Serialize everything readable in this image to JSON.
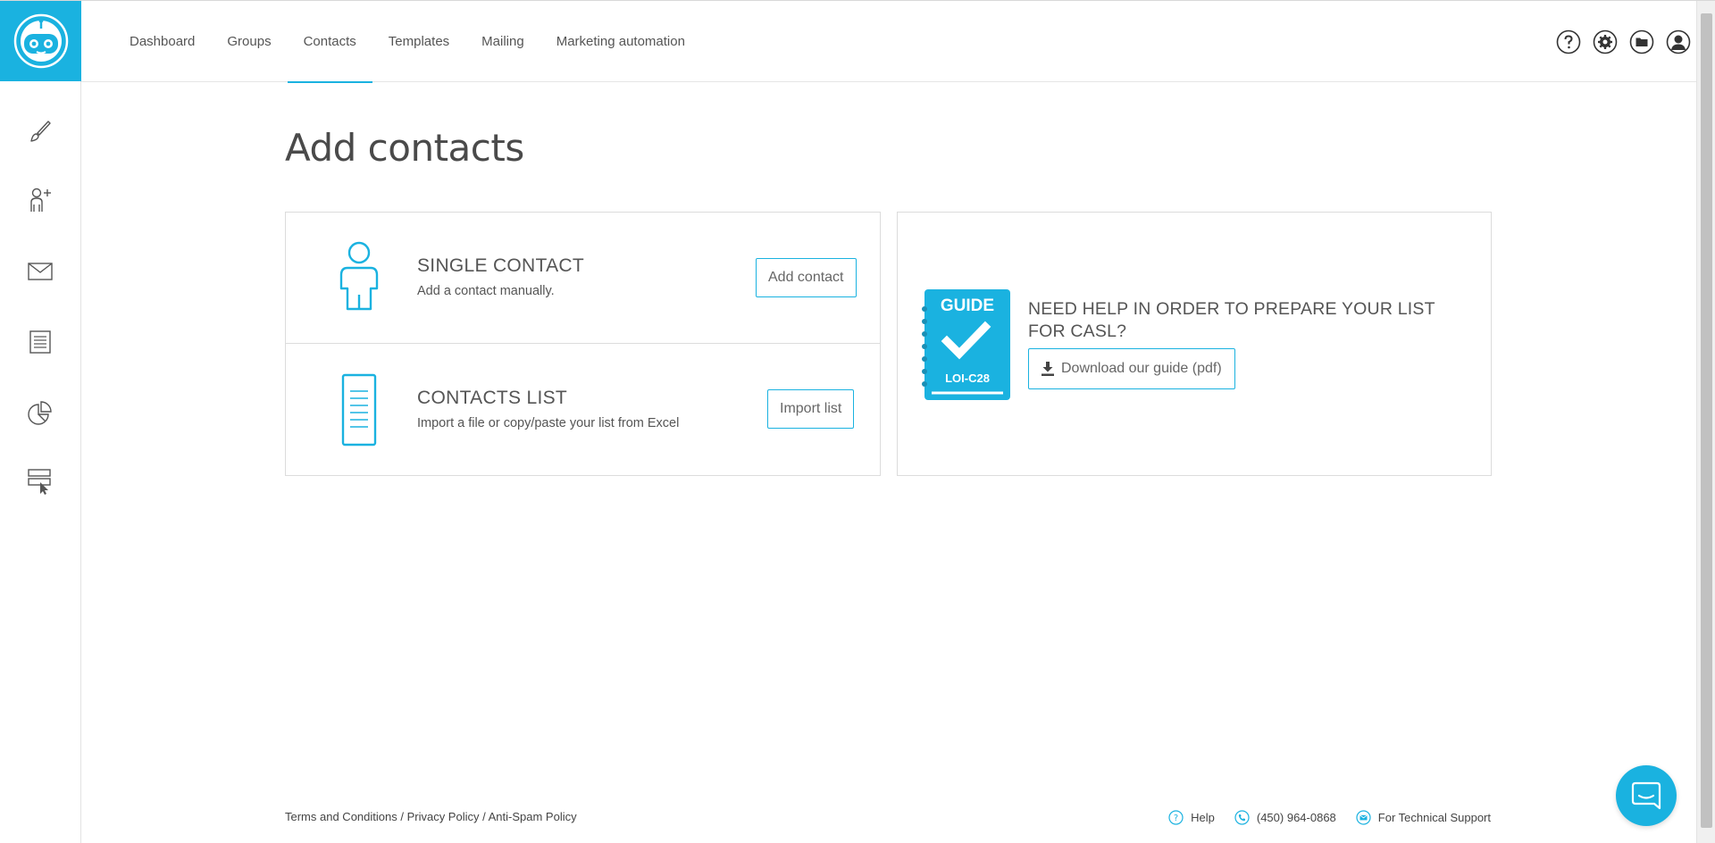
{
  "nav": {
    "tabs": [
      {
        "label": "Dashboard"
      },
      {
        "label": "Groups"
      },
      {
        "label": "Contacts"
      },
      {
        "label": "Templates"
      },
      {
        "label": "Mailing"
      },
      {
        "label": "Marketing automation"
      }
    ],
    "active_tab": "Contacts"
  },
  "sidebar": {
    "items": [
      "brush-icon",
      "add-contact-icon",
      "mail-icon",
      "document-icon",
      "report-chart-icon",
      "form-cursor-icon"
    ]
  },
  "header_icons": [
    "help-icon",
    "settings-icon",
    "folder-icon",
    "user-icon"
  ],
  "page": {
    "title": "Add contacts"
  },
  "single_contact": {
    "title": "SINGLE CONTACT",
    "subtitle": "Add a contact manually.",
    "button": "Add contact"
  },
  "contacts_list": {
    "title": "CONTACTS LIST",
    "subtitle": "Import a file or copy/paste your list from Excel",
    "button": "Import list"
  },
  "guide": {
    "badge_top": "GUIDE",
    "badge_bottom": "LOI-C28",
    "title": "NEED HELP IN ORDER TO PREPARE YOUR LIST FOR CASL?",
    "button": "Download our guide (pdf)"
  },
  "footer": {
    "terms": "Terms and Conditions",
    "privacy": "Privacy Policy",
    "antispam": "Anti-Spam Policy",
    "separator": " / ",
    "help": "Help",
    "phone": "(450) 964-0868",
    "support": "For Technical Support"
  },
  "colors": {
    "accent": "#1ab2e0",
    "text": "#555555",
    "border": "#dcdcdc"
  }
}
